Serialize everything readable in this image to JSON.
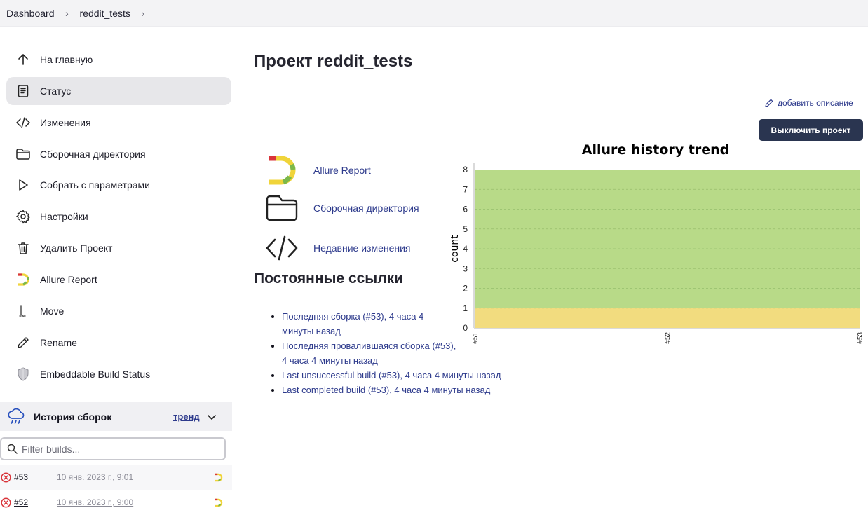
{
  "breadcrumb": {
    "items": [
      "Dashboard",
      "reddit_tests"
    ]
  },
  "sidebar": {
    "items": [
      {
        "label": "На главную",
        "icon": "arrow-up-icon"
      },
      {
        "label": "Статус",
        "icon": "document-icon"
      },
      {
        "label": "Изменения",
        "icon": "code-icon"
      },
      {
        "label": "Сборочная директория",
        "icon": "folder-icon"
      },
      {
        "label": "Собрать с параметрами",
        "icon": "play-icon"
      },
      {
        "label": "Настройки",
        "icon": "gear-icon"
      },
      {
        "label": "Удалить Проект",
        "icon": "trash-icon"
      },
      {
        "label": "Allure Report",
        "icon": "allure-icon"
      },
      {
        "label": "Move",
        "icon": "move-icon"
      },
      {
        "label": "Rename",
        "icon": "pencil-icon"
      },
      {
        "label": "Embeddable Build Status",
        "icon": "shield-icon"
      }
    ]
  },
  "build_history": {
    "title": "История сборок",
    "trend_label": "тренд",
    "filter_placeholder": "Filter builds...",
    "builds": [
      {
        "number": "#53",
        "date": "10 янв. 2023 г., 9:01",
        "status": "failed"
      },
      {
        "number": "#52",
        "date": "10 янв. 2023 г., 9:00",
        "status": "failed"
      }
    ]
  },
  "main": {
    "title": "Проект reddit_tests",
    "add_description": "добавить описание",
    "disable_button": "Выключить проект",
    "links": [
      {
        "label": "Allure Report",
        "icon": "allure-icon"
      },
      {
        "label": "Сборочная директория",
        "icon": "folder-icon"
      },
      {
        "label": "Недавние изменения",
        "icon": "code-icon"
      }
    ],
    "permalinks_title": "Постоянные ссылки",
    "permalinks": [
      "Последняя сборка (#53), 4 часа 4 минуты назад",
      "Последняя провалившаяся сборка (#53), 4 часа 4 минуты назад",
      "Last unsuccessful build (#53), 4 часа 4 минуты назад",
      "Last completed build (#53), 4 часа 4 минуты назад"
    ]
  },
  "chart_data": {
    "type": "area",
    "title": "Allure history trend",
    "ylabel": "count",
    "xlabel": "",
    "categories": [
      "#51",
      "#52",
      "#53"
    ],
    "ylim": [
      0,
      8
    ],
    "yticks": [
      "0",
      "1",
      "2",
      "3",
      "4",
      "5",
      "6",
      "7",
      "8"
    ],
    "stacked": true,
    "series": [
      {
        "values": [
          1,
          1,
          1
        ],
        "color": "#f2dc7f"
      },
      {
        "values": [
          7,
          7,
          7
        ],
        "color": "#b8da88"
      }
    ],
    "grid": true
  },
  "colors": {
    "accent_link": "#2d3a8c",
    "button_bg": "#2a3550",
    "fail_red": "#d9343a"
  }
}
